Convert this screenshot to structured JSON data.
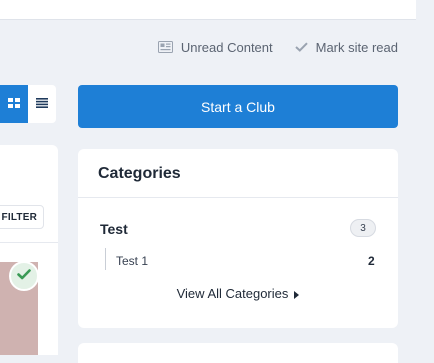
{
  "header": {
    "unread_content": "Unread Content",
    "mark_site_read": "Mark site read"
  },
  "toolbar": {
    "filter_label": "FILTER"
  },
  "sidebar": {
    "start_club_label": "Start a Club",
    "categories": {
      "title": "Categories",
      "items": [
        {
          "name": "Test",
          "count": "3",
          "children": [
            {
              "name": "Test 1",
              "count": "2"
            }
          ]
        }
      ],
      "view_all_label": "View All Categories"
    }
  },
  "colors": {
    "accent": "#1e7fd6",
    "page_bg": "#eef1f6",
    "check_green": "#3a9a55"
  }
}
